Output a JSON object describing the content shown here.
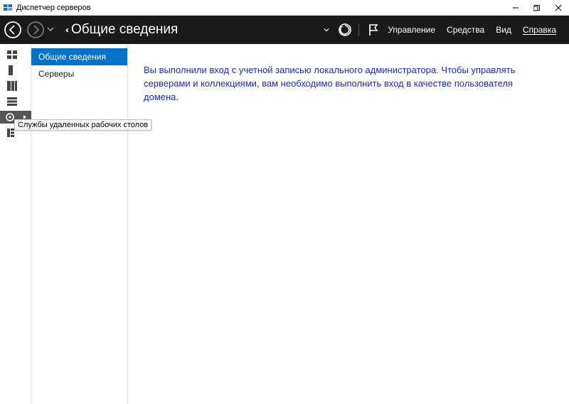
{
  "window": {
    "title": "Диспетчер серверов"
  },
  "breadcrumb": {
    "caret": "‹‹",
    "title": "Общие сведения"
  },
  "header_menu": {
    "manage": "Управление",
    "tools": "Средства",
    "view": "Вид",
    "help": "Справка"
  },
  "subnav": {
    "overview": "Общие сведения",
    "servers": "Серверы"
  },
  "content": {
    "warning": "Вы выполнили вход с учетной записью локального администратора. Чтобы управлять серверами и коллекциями, вам необходимо выполнить вход в качестве пользователя домена."
  },
  "tooltip": {
    "text": "Службы удаленных рабочих столов"
  }
}
